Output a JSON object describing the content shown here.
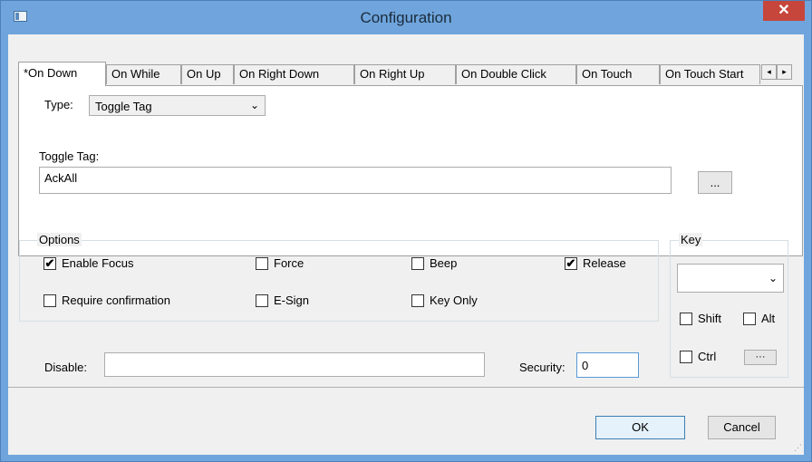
{
  "window": {
    "title": "Configuration",
    "close_glyph": "✕"
  },
  "tabs": [
    "*On Down",
    "On While",
    "On Up",
    "On Right Down",
    "On Right Up",
    "On Double Click",
    "On Touch",
    "On Touch Start"
  ],
  "tab_scroll": {
    "left": "◂",
    "right": "▸"
  },
  "action": {
    "type_label": "Type:",
    "type_value": "Toggle Tag",
    "toggle_tag_label": "Toggle Tag:",
    "toggle_tag_value": "AckAll",
    "browse_label": "..."
  },
  "options": {
    "title": "Options",
    "items": [
      {
        "label": "Enable Focus",
        "checked": true
      },
      {
        "label": "Force",
        "checked": false
      },
      {
        "label": "Beep",
        "checked": false
      },
      {
        "label": "Release",
        "checked": true
      },
      {
        "label": "Require confirmation",
        "checked": false
      },
      {
        "label": "E-Sign",
        "checked": false
      },
      {
        "label": "Key Only",
        "checked": false
      }
    ]
  },
  "key": {
    "title": "Key",
    "value": "",
    "shift_label": "Shift",
    "alt_label": "Alt",
    "ctrl_label": "Ctrl",
    "more_label": "···"
  },
  "disable": {
    "label": "Disable:",
    "value": ""
  },
  "security": {
    "label": "Security:",
    "value": "0"
  },
  "buttons": {
    "ok": "OK",
    "cancel": "Cancel"
  },
  "icons": {
    "dropdown": "⌄",
    "check": "✔"
  }
}
